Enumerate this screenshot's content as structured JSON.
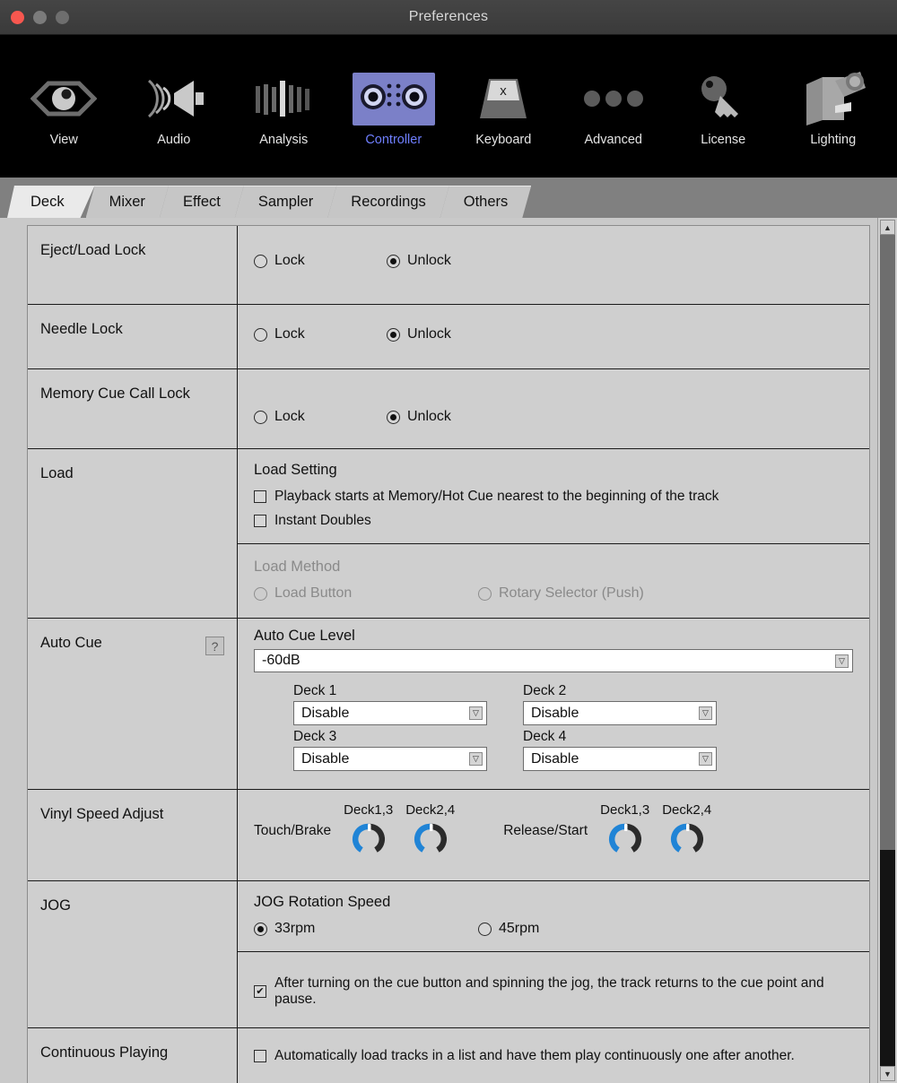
{
  "window": {
    "title": "Preferences",
    "close_label": "",
    "minimize_label": "",
    "maximize_label": ""
  },
  "toolbar": {
    "items": [
      {
        "label": "View",
        "icon": "eye-icon",
        "active": false
      },
      {
        "label": "Audio",
        "icon": "speaker-icon",
        "active": false
      },
      {
        "label": "Analysis",
        "icon": "waveform-icon",
        "active": false
      },
      {
        "label": "Controller",
        "icon": "controller-icon",
        "active": true
      },
      {
        "label": "Keyboard",
        "icon": "keycap-icon",
        "active": false
      },
      {
        "label": "Advanced",
        "icon": "ellipsis-icon",
        "active": false
      },
      {
        "label": "License",
        "icon": "key-icon",
        "active": false
      },
      {
        "label": "Lighting",
        "icon": "moving-head-light-icon",
        "active": false
      }
    ],
    "accent_active": "#6f7fff",
    "accent_active_bg": "#7b80c8"
  },
  "tabs": {
    "items": [
      {
        "label": "Deck",
        "active": true
      },
      {
        "label": "Mixer",
        "active": false
      },
      {
        "label": "Effect",
        "active": false
      },
      {
        "label": "Sampler",
        "active": false
      },
      {
        "label": "Recordings",
        "active": false
      },
      {
        "label": "Others",
        "active": false
      }
    ]
  },
  "rows": {
    "eject_load_lock": {
      "label": "Eject/Load Lock",
      "lock_label": "Lock",
      "unlock_label": "Unlock",
      "selected": "Unlock"
    },
    "needle_lock": {
      "label": "Needle Lock",
      "lock_label": "Lock",
      "unlock_label": "Unlock",
      "selected": "Unlock"
    },
    "memory_cue_call_lock": {
      "label": "Memory Cue Call Lock",
      "lock_label": "Lock",
      "unlock_label": "Unlock",
      "selected": "Unlock"
    },
    "load": {
      "label": "Load",
      "load_setting_title": "Load Setting",
      "playback_starts_label": "Playback starts at Memory/Hot Cue nearest to the beginning of the track",
      "playback_starts_checked": false,
      "instant_doubles_label": "Instant Doubles",
      "instant_doubles_checked": false,
      "load_method_title": "Load Method",
      "load_button_label": "Load Button",
      "rotary_selector_label": "Rotary Selector (Push)",
      "load_method_disabled": true,
      "load_method_selected": ""
    },
    "auto_cue": {
      "label": "Auto Cue",
      "help_glyph": "?",
      "level_title": "Auto Cue Level",
      "level_value": "-60dB",
      "decks": [
        {
          "label": "Deck 1",
          "value": "Disable"
        },
        {
          "label": "Deck 2",
          "value": "Disable"
        },
        {
          "label": "Deck 3",
          "value": "Disable"
        },
        {
          "label": "Deck 4",
          "value": "Disable"
        }
      ]
    },
    "vinyl_speed_adjust": {
      "label": "Vinyl Speed Adjust",
      "groups": [
        {
          "name": "Touch/Brake",
          "knobs": [
            {
              "label": "Deck1,3",
              "value": 50
            },
            {
              "label": "Deck2,4",
              "value": 50
            }
          ]
        },
        {
          "name": "Release/Start",
          "knobs": [
            {
              "label": "Deck1,3",
              "value": 50
            },
            {
              "label": "Deck2,4",
              "value": 50
            }
          ]
        }
      ],
      "knob_fill_color": "#2084d6",
      "knob_track_color": "#2b2b2b"
    },
    "jog": {
      "label": "JOG",
      "rotation_title": "JOG Rotation Speed",
      "speed_33_label": "33rpm",
      "speed_45_label": "45rpm",
      "selected_speed": "33rpm",
      "cue_return_label": "After turning on the cue button and spinning the jog, the track returns to the cue point and pause.",
      "cue_return_checked": true
    },
    "continuous_playing": {
      "label": "Continuous Playing",
      "auto_load_label": "Automatically load tracks in a list and have them play continuously one after another.",
      "auto_load_checked": false
    }
  },
  "scrollbar": {
    "up_glyph": "▲",
    "down_glyph": "▼",
    "thumb_percent": 74
  },
  "select_arrow_glyph": "▽"
}
